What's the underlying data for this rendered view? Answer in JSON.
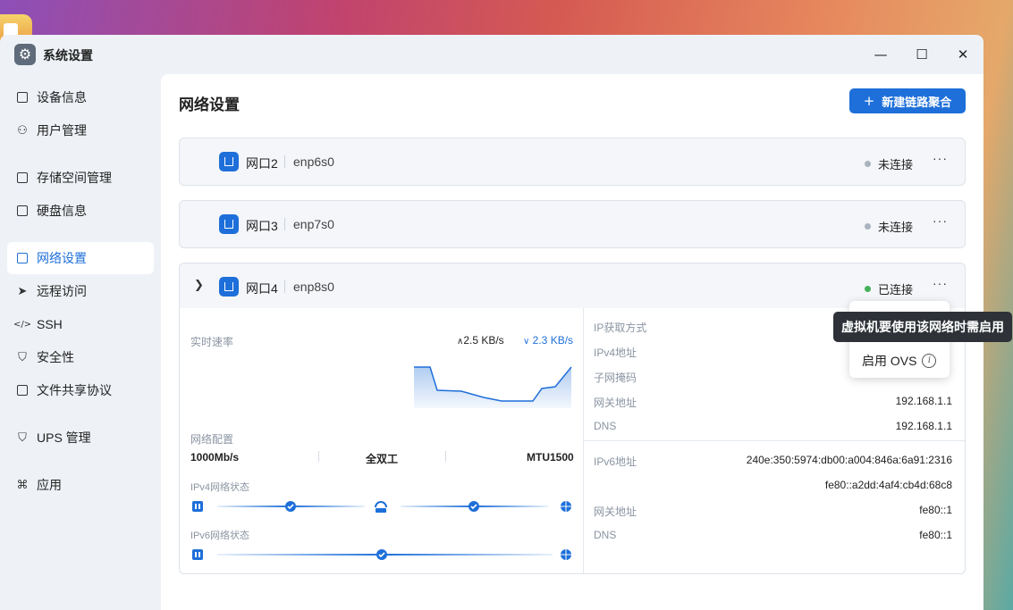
{
  "window": {
    "title": "系统设置",
    "icon": "gear-icon",
    "minimize_icon": "minimize-icon",
    "maximize_icon": "maximize-icon",
    "close_icon": "close-icon"
  },
  "sidebar": {
    "items": [
      {
        "label": "设备信息",
        "icon": "device-icon"
      },
      {
        "label": "用户管理",
        "icon": "user-icon"
      },
      {
        "label": "存储空间管理",
        "icon": "storage-icon"
      },
      {
        "label": "硬盘信息",
        "icon": "disk-icon"
      },
      {
        "label": "网络设置",
        "icon": "network-icon",
        "active": true
      },
      {
        "label": "远程访问",
        "icon": "send-icon"
      },
      {
        "label": "SSH",
        "icon": "code-icon"
      },
      {
        "label": "安全性",
        "icon": "shield-icon"
      },
      {
        "label": "文件共享协议",
        "icon": "document-icon"
      },
      {
        "label": "UPS 管理",
        "icon": "shield-icon"
      },
      {
        "label": "应用",
        "icon": "apps-icon"
      }
    ]
  },
  "main": {
    "title": "网络设置",
    "new_button": "新建链路聚合",
    "ports": [
      {
        "name": "网口2",
        "device": "enp6s0",
        "status": "未连接"
      },
      {
        "name": "网口3",
        "device": "enp7s0",
        "status": "未连接"
      },
      {
        "name": "网口4",
        "device": "enp8s0",
        "status": "已连接"
      }
    ],
    "detail": {
      "speed_label": "实时速率",
      "upload": "2.5 KB/s",
      "download": "2.3 KB/s",
      "config_label": "网络配置",
      "link_speed": "1000Mb/s",
      "duplex": "全双工",
      "mtu": "MTU1500",
      "ipv4_status_label": "IPv4网络状态",
      "ipv6_status_label": "IPv6网络状态",
      "ipv4": [
        {
          "label": "IP获取方式",
          "value": ""
        },
        {
          "label": "IPv4地址",
          "value": ""
        },
        {
          "label": "子网掩码",
          "value": ""
        },
        {
          "label": "网关地址",
          "value": "192.168.1.1"
        },
        {
          "label": "DNS",
          "value": "192.168.1.1"
        }
      ],
      "ipv6": [
        {
          "label": "IPv6地址",
          "value": "240e:350:5974:db00:a004:846a:6a91:2316"
        },
        {
          "label": "",
          "value": "fe80::a2dd:4af4:cb4d:68c8"
        },
        {
          "label": "网关地址",
          "value": "fe80::1"
        },
        {
          "label": "DNS",
          "value": "fe80::1"
        }
      ]
    }
  },
  "menu": {
    "item": "启用 OVS"
  },
  "tooltip": "虚拟机要使用该网络时需启用",
  "colors": {
    "accent": "#1e6fd9",
    "connected": "#45b05a",
    "disconnected": "#a9b3bf"
  }
}
